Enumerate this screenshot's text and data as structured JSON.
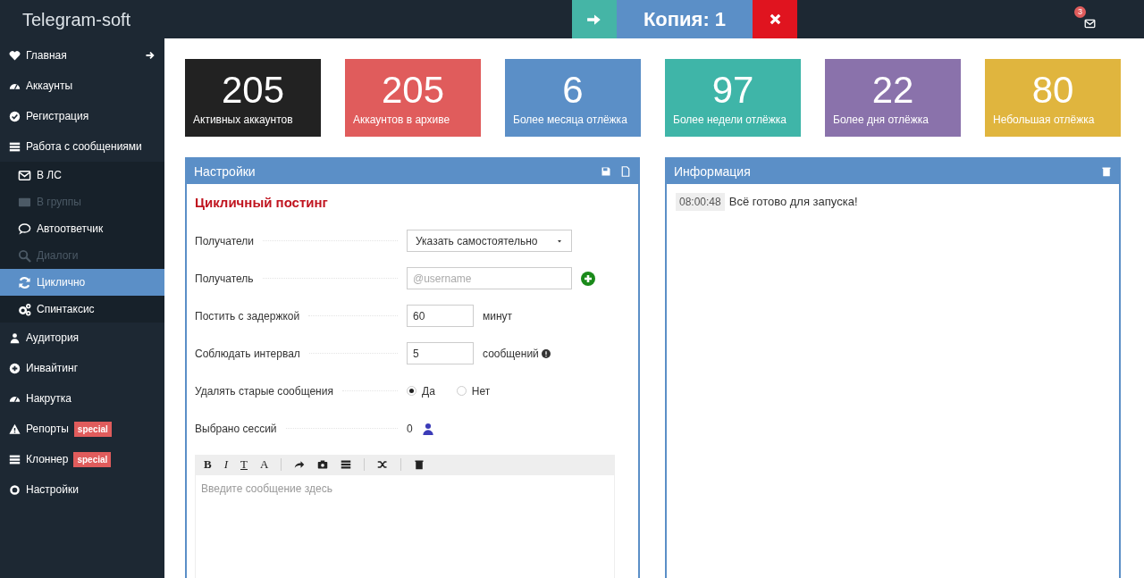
{
  "header": {
    "title": "Telegram-soft",
    "copy_label": "Копия: 1",
    "notification_count": "3"
  },
  "sidebar": {
    "items": [
      {
        "label": "Главная",
        "selected": false,
        "has_arrow": true
      },
      {
        "label": "Аккаунты",
        "selected": false
      },
      {
        "label": "Регистрация",
        "selected": false
      },
      {
        "label": "Работа с сообщениями",
        "selected": false,
        "children": [
          {
            "label": "В ЛС",
            "selected": false,
            "disabled": false
          },
          {
            "label": "В группы",
            "selected": false,
            "disabled": true
          },
          {
            "label": "Автоответчик",
            "selected": false,
            "disabled": false
          },
          {
            "label": "Диалоги",
            "selected": false,
            "disabled": true
          },
          {
            "label": "Циклично",
            "selected": true,
            "disabled": false
          },
          {
            "label": "Спинтаксис",
            "selected": false,
            "disabled": false
          }
        ]
      },
      {
        "label": "Аудитория",
        "selected": false
      },
      {
        "label": "Инвайтинг",
        "selected": false
      },
      {
        "label": "Накрутка",
        "selected": false
      },
      {
        "label": "Репорты",
        "selected": false,
        "badge": "special"
      },
      {
        "label": "Клоннер",
        "selected": false,
        "badge": "special"
      },
      {
        "label": "Настройки",
        "selected": false
      }
    ]
  },
  "stats": [
    {
      "value": "205",
      "label": "Активных аккаунтов",
      "color": "#222222"
    },
    {
      "value": "205",
      "label": "Аккаунтов в архиве",
      "color": "#e05c5c"
    },
    {
      "value": "6",
      "label": "Более месяца отлёжка",
      "color": "#5b8fc7"
    },
    {
      "value": "97",
      "label": "Более недели отлёжка",
      "color": "#3fb5a8"
    },
    {
      "value": "22",
      "label": "Более дня отлёжка",
      "color": "#8a72ab"
    },
    {
      "value": "80",
      "label": "Небольшая отлёжка",
      "color": "#e0b53e"
    }
  ],
  "settings_panel": {
    "title": "Настройки",
    "heading": "Цикличный постинг",
    "fields": [
      {
        "kind": "select",
        "label": "Получатели",
        "value": "Указать самостоятельно"
      },
      {
        "kind": "input_add",
        "label": "Получатель",
        "placeholder": "@username"
      },
      {
        "kind": "input_unit",
        "label": "Постить с задержкой",
        "value": "60",
        "unit": "минут",
        "info": false
      },
      {
        "kind": "input_unit",
        "label": "Соблюдать интервал",
        "value": "5",
        "unit": "сообщений",
        "info": true
      },
      {
        "kind": "radio",
        "label": "Удалять старые сообщения",
        "options": [
          {
            "label": "Да",
            "selected": true
          },
          {
            "label": "Нет",
            "selected": false
          }
        ]
      },
      {
        "kind": "count",
        "label": "Выбрано сессий",
        "value": "0"
      }
    ],
    "editor": {
      "toolbar": [
        "B",
        "I",
        "T",
        "A"
      ],
      "placeholder": "Введите сообщение здесь"
    }
  },
  "info_panel": {
    "title": "Информация",
    "log": [
      {
        "time": "08:00:48",
        "text": "Всё готово для запуска!"
      }
    ]
  }
}
